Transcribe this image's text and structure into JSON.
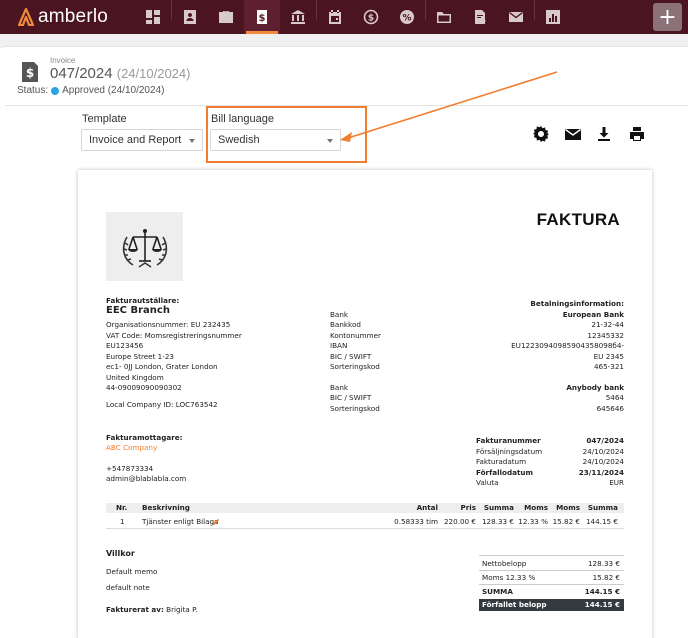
{
  "app": {
    "logo_text": "amberlo"
  },
  "nav": {
    "items": [
      {
        "icon": "dashboard-icon"
      },
      {
        "icon": "contacts-icon"
      },
      {
        "icon": "briefcase-icon"
      },
      {
        "icon": "invoice-icon",
        "active": true
      },
      {
        "icon": "bank-icon"
      },
      {
        "icon": "calendar-icon"
      },
      {
        "icon": "time-money-icon"
      },
      {
        "icon": "expenses-icon"
      },
      {
        "icon": "folder-icon"
      },
      {
        "icon": "document-settings-icon"
      },
      {
        "icon": "mail-icon"
      },
      {
        "icon": "reports-icon"
      }
    ],
    "add_label": "+"
  },
  "invoice_header": {
    "label": "Invoice",
    "number": "047/2024",
    "date": "(24/10/2024)",
    "status_label": "Status:",
    "status_value": "Approved (24/10/2024)",
    "status_color": "#2aa4e0"
  },
  "controls": {
    "template_label": "Template",
    "template_value": "Invoice and Report",
    "language_label": "Bill language",
    "language_value": "Swedish"
  },
  "toolbar": [
    "settings-icon",
    "email-icon",
    "download-icon",
    "print-icon"
  ],
  "doc": {
    "title": "FAKTURA",
    "seller": {
      "heading": "Fakturautställare:",
      "name": "EEC Branch",
      "lines": [
        "Organisationsnummer: EU 232435",
        "VAT Code: Momsregistreringsnummer",
        "EU123456",
        "Europe Street 1-23",
        "ec1- 0JJ London, Grater London",
        "United Kingdom",
        "44-09009090090302",
        "Local Company ID: LOC763542"
      ]
    },
    "bank_labels_1": [
      "Bank",
      "Bankkod",
      "Kontonummer",
      "IBAN",
      "BIC / SWIFT",
      "Sorteringskod"
    ],
    "bank_labels_2": [
      "Bank",
      "BIC / SWIFT",
      "Sorteringskod"
    ],
    "payment": {
      "heading": "Betalningsinformation:",
      "bank1": "European Bank",
      "values1": [
        "21-32-44",
        "12345332",
        "EU12230940985904358098б4-",
        "EU 2345",
        "465-321"
      ],
      "bank2": "Anybody bank",
      "values2": [
        "5464",
        "645646"
      ]
    },
    "recipient": {
      "heading": "Fakturamottagare:",
      "company": "ABC Company",
      "phone": "+547873334",
      "email": "admin@blablabla.com"
    },
    "invoice_info": [
      {
        "label": "Fakturanummer",
        "value": "047/2024",
        "bold": true
      },
      {
        "label": "Försäljningsdatum",
        "value": "24/10/2024",
        "bold": false
      },
      {
        "label": "Fakturadatum",
        "value": "24/10/2024",
        "bold": false
      },
      {
        "label": "Förfallodatum",
        "value": "23/11/2024",
        "bold": true
      },
      {
        "label": "Valuta",
        "value": "EUR",
        "bold": false
      }
    ],
    "table": {
      "headers": [
        "Nr.",
        "Beskrivning",
        "Antal",
        "Pris",
        "Summa",
        "Moms",
        "Moms",
        "Summa"
      ],
      "rows": [
        {
          "nr": "1",
          "desc": "Tjänster enligt Bilaga",
          "antal": "0.58333 tim",
          "pris": "220.00 €",
          "summa": "128.33 €",
          "moms_pct": "12.33 %",
          "moms": "15.82 €",
          "total": "144.15 €"
        }
      ]
    },
    "villkor": {
      "heading": "Villkor",
      "memo": "Default memo",
      "note": "default note"
    },
    "invoiced_by": {
      "label": "Fakturerat av:",
      "name": "Brigita P."
    },
    "totals": [
      {
        "label": "Nettobelopp",
        "value": "128.33 €"
      },
      {
        "label": "Moms 12.33 %",
        "value": "15.82 €"
      },
      {
        "label": "SUMMA",
        "value": "144.15 €"
      },
      {
        "label": "Förfallet belopp",
        "value": "144.15 €"
      }
    ]
  },
  "colors": {
    "topbar": "#4a1420",
    "accent": "#f07e2e"
  }
}
